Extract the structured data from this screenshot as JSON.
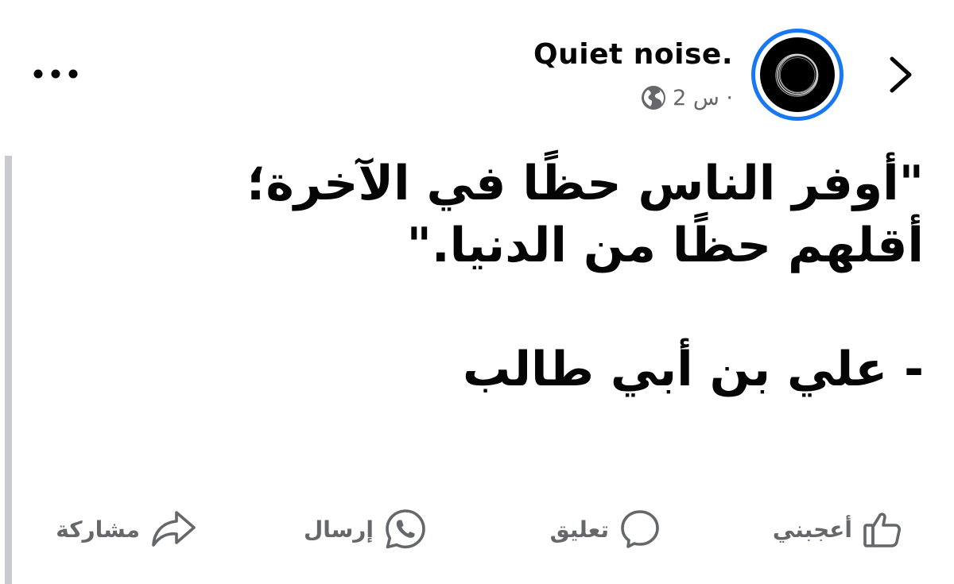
{
  "post": {
    "author": "Quiet noise.",
    "time": "2 س ·",
    "audience_icon": "globe-icon",
    "text": "\"أوفر الناس حظًا في الآخرة؛ أقلهم حظًا من الدنيا.\"\n\n- علي بن أبي طالب"
  },
  "header": {
    "back_icon": "chevron-right-icon",
    "more_icon": "more-horizontal-icon"
  },
  "actions": {
    "like": {
      "label": "أعجبني",
      "icon": "thumbs-up-icon"
    },
    "comment": {
      "label": "تعليق",
      "icon": "comment-icon"
    },
    "send": {
      "label": "إرسال",
      "icon": "whatsapp-icon"
    },
    "share": {
      "label": "مشاركة",
      "icon": "share-icon"
    }
  },
  "colors": {
    "accent": "#1877f2",
    "text": "#050505",
    "secondary_text": "#65676b",
    "side_bar": "#c8cacd"
  }
}
